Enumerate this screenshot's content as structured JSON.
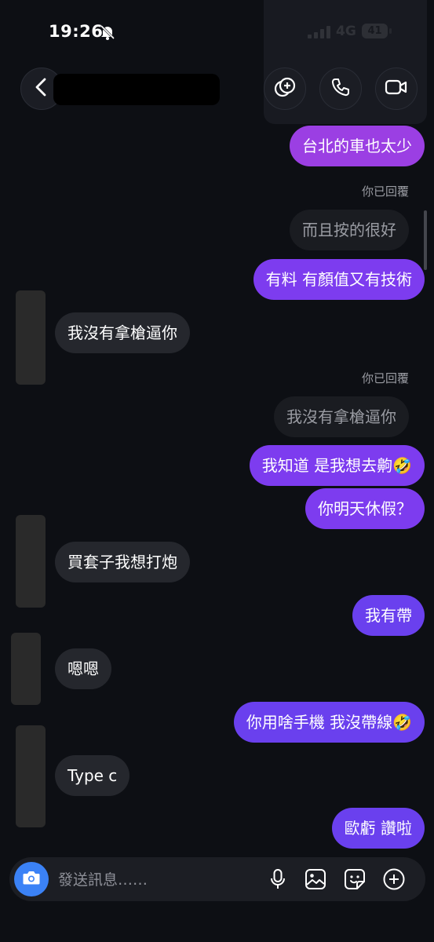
{
  "status_bar": {
    "time": "19:26",
    "network": "4G",
    "battery": "41",
    "icons": [
      "bell-slash-icon",
      "signal-icon",
      "battery-icon"
    ]
  },
  "header": {
    "icons": [
      "chevron-left-icon",
      "effects-icon",
      "phone-icon",
      "video-camera-icon"
    ]
  },
  "messages": [
    {
      "kind": "sent",
      "text": "台北的車也太少"
    },
    {
      "kind": "reply_label",
      "text": "你已回覆"
    },
    {
      "kind": "reply_quote",
      "text": "而且按的很好"
    },
    {
      "kind": "sent",
      "text": "有料 有顏值又有技術"
    },
    {
      "kind": "received",
      "text": "我沒有拿槍逼你"
    },
    {
      "kind": "reply_label",
      "text": "你已回覆"
    },
    {
      "kind": "reply_quote",
      "text": "我沒有拿槍逼你"
    },
    {
      "kind": "sent",
      "text": "我知道 是我想去齁🤣"
    },
    {
      "kind": "sent",
      "text": "你明天休假？"
    },
    {
      "kind": "received",
      "text": "買套子我想打炮"
    },
    {
      "kind": "sent",
      "text": "我有帶"
    },
    {
      "kind": "received",
      "text": "嗯嗯"
    },
    {
      "kind": "sent",
      "text": "你用啥手機 我沒帶線🤣"
    },
    {
      "kind": "received",
      "text": "Type c"
    },
    {
      "kind": "sent",
      "text": "歐虧 讚啦"
    }
  ],
  "composer": {
    "placeholder": "發送訊息……",
    "icons": [
      "camera-icon",
      "microphone-icon",
      "image-icon",
      "sticker-icon",
      "plus-circle-icon"
    ]
  },
  "colors": {
    "background": "#0d0f14",
    "sent_bubble": "#7b3ff2",
    "received_bubble": "#25272d",
    "camera_button": "#3b82f6"
  }
}
